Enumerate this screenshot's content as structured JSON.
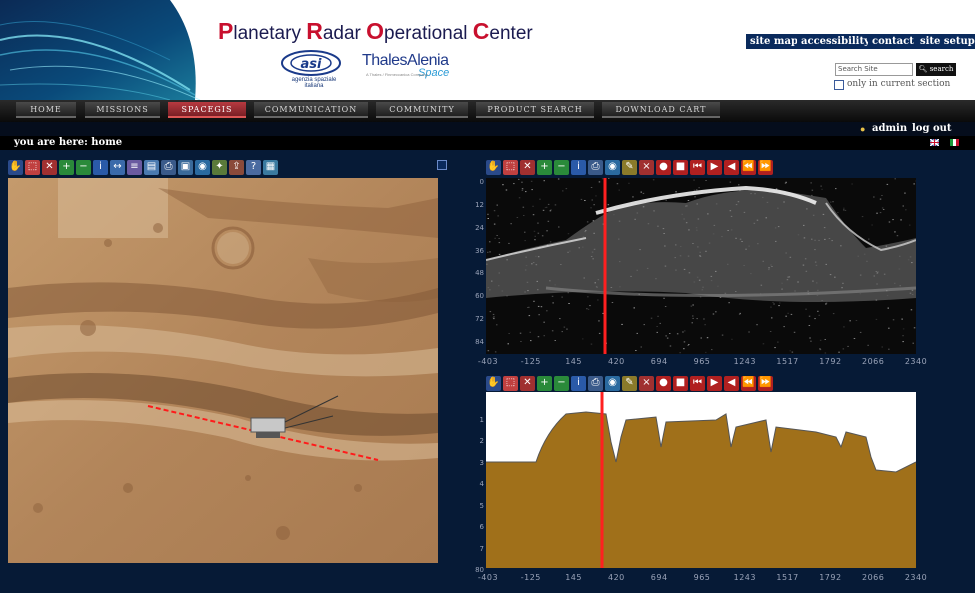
{
  "header": {
    "title_caps": [
      "P",
      "R",
      "O",
      "C"
    ],
    "title_rest": [
      "lanetary ",
      "adar ",
      "perational ",
      "enter"
    ],
    "asi_text": "agenzia spaziale italiana",
    "thales_name": "ThalesAlenia",
    "thales_space": "Space",
    "thales_tag": "A Thales / Finmeccanica Company"
  },
  "top_links": [
    {
      "label": "site map"
    },
    {
      "label": "accessibility"
    },
    {
      "label": "contact"
    },
    {
      "label": "site setup"
    }
  ],
  "search": {
    "placeholder": "Search Site",
    "button_label": "search",
    "only_current_label": "only in current section"
  },
  "nav": {
    "tabs": [
      {
        "label": "HOME",
        "active": false
      },
      {
        "label": "MISSIONS",
        "active": false
      },
      {
        "label": "SPACEGIS",
        "active": true
      },
      {
        "label": "COMMUNICATION",
        "active": false
      },
      {
        "label": "COMMUNITY",
        "active": false
      },
      {
        "label": "PRODUCT SEARCH",
        "active": false
      },
      {
        "label": "DOWNLOAD CART",
        "active": false
      }
    ]
  },
  "user": {
    "name": "admin",
    "logout": "log out"
  },
  "breadcrumb": "you are here: home",
  "map_toolbar": {
    "icons": [
      "pan-icon",
      "zoom-box-icon",
      "clear-icon",
      "zoom-in-icon",
      "zoom-out-icon",
      "identify-icon",
      "measure-icon",
      "layers-icon",
      "legend-icon",
      "print-icon",
      "save-icon",
      "globe-icon",
      "satellite-icon",
      "export-icon",
      "query-icon",
      "table-icon"
    ]
  },
  "radar_toolbar": {
    "icons": [
      "pan-icon",
      "zoom-box-icon",
      "clear-icon",
      "zoom-in-icon",
      "zoom-out-icon",
      "identify-icon",
      "print-icon",
      "globe-icon",
      "edit-icon",
      "close-icon",
      "record-icon",
      "stop-icon",
      "first-icon",
      "next-icon",
      "prev-icon",
      "rewind-icon",
      "forward-icon"
    ]
  },
  "radar": {
    "y_ticks": [
      "0",
      "12",
      "24",
      "36",
      "48",
      "60",
      "72",
      "84"
    ],
    "x_ticks": [
      "-403",
      "-125",
      "145",
      "420",
      "694",
      "965",
      "1243",
      "1517",
      "1792",
      "2066",
      "2340"
    ]
  },
  "profile": {
    "y_ticks": [
      "1",
      "2",
      "3",
      "4",
      "5",
      "6",
      "7",
      "80"
    ],
    "x_ticks": [
      "-403",
      "-125",
      "145",
      "420",
      "694",
      "965",
      "1243",
      "1517",
      "1792",
      "2066",
      "2340"
    ]
  },
  "colors": {
    "accent": "#c8102e",
    "nav_active": "#9a2b31",
    "link_bg": "#0a2a5c",
    "profile_fill": "#a0701a",
    "cursor_line": "#ff2020"
  }
}
